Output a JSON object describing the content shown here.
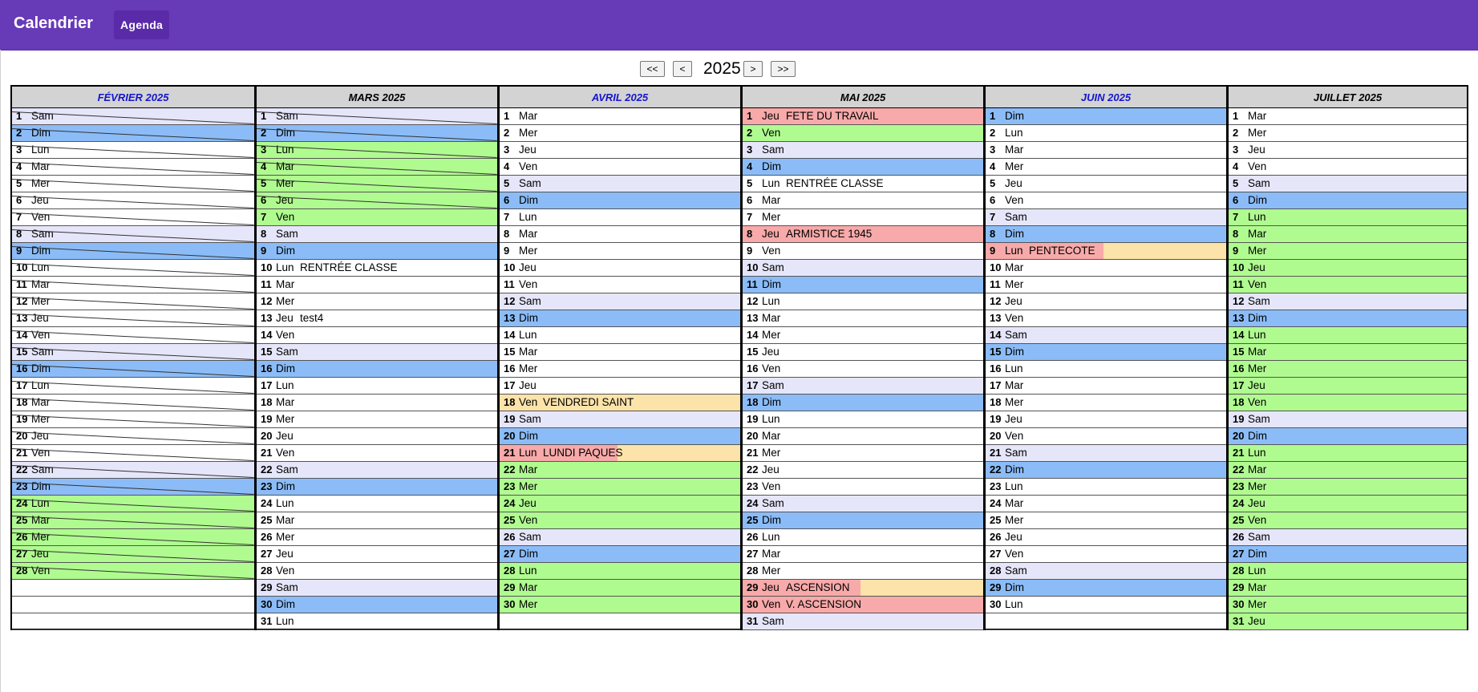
{
  "app": {
    "title": "Calendrier",
    "agenda_label": "Agenda"
  },
  "nav": {
    "year": "2025",
    "first": "<<",
    "prev": "<",
    "next": ">",
    "last": ">>"
  },
  "colors": {
    "appbar": "#673ab7",
    "saturday": "#e6e6fa",
    "sunday": "#8bbcf7",
    "school_holiday": "#b0fb90",
    "public_holiday": "#f8a9a9",
    "bridge_day": "#fbe3aa",
    "current_month_title": "#1515d0"
  },
  "months": [
    {
      "title": "FÉVRIER 2025",
      "title_blue": true,
      "days": [
        {
          "n": "1",
          "wd": "Sam",
          "c": "sat",
          "x": 1
        },
        {
          "n": "2",
          "wd": "Dim",
          "c": "sun",
          "x": 1
        },
        {
          "n": "3",
          "wd": "Lun",
          "x": 1
        },
        {
          "n": "4",
          "wd": "Mar",
          "x": 1
        },
        {
          "n": "5",
          "wd": "Mer",
          "x": 1
        },
        {
          "n": "6",
          "wd": "Jeu",
          "x": 1
        },
        {
          "n": "7",
          "wd": "Ven",
          "x": 1
        },
        {
          "n": "8",
          "wd": "Sam",
          "c": "sat",
          "x": 1
        },
        {
          "n": "9",
          "wd": "Dim",
          "c": "sun",
          "x": 1
        },
        {
          "n": "10",
          "wd": "Lun",
          "x": 1
        },
        {
          "n": "11",
          "wd": "Mar",
          "x": 1
        },
        {
          "n": "12",
          "wd": "Mer",
          "x": 1
        },
        {
          "n": "13",
          "wd": "Jeu",
          "x": 1
        },
        {
          "n": "14",
          "wd": "Ven",
          "x": 1
        },
        {
          "n": "15",
          "wd": "Sam",
          "c": "sat",
          "x": 1
        },
        {
          "n": "16",
          "wd": "Dim",
          "c": "sun",
          "x": 1
        },
        {
          "n": "17",
          "wd": "Lun",
          "x": 1
        },
        {
          "n": "18",
          "wd": "Mar",
          "x": 1
        },
        {
          "n": "19",
          "wd": "Mer",
          "x": 1
        },
        {
          "n": "20",
          "wd": "Jeu",
          "x": 1
        },
        {
          "n": "21",
          "wd": "Ven",
          "x": 1
        },
        {
          "n": "22",
          "wd": "Sam",
          "c": "sat",
          "x": 1
        },
        {
          "n": "23",
          "wd": "Dim",
          "c": "sun",
          "x": 1
        },
        {
          "n": "24",
          "wd": "Lun",
          "c": "green",
          "x": 1
        },
        {
          "n": "25",
          "wd": "Mar",
          "c": "green",
          "x": 1
        },
        {
          "n": "26",
          "wd": "Mer",
          "c": "green",
          "x": 1
        },
        {
          "n": "27",
          "wd": "Jeu",
          "c": "green",
          "x": 1
        },
        {
          "n": "28",
          "wd": "Ven",
          "c": "green",
          "x": 1
        }
      ]
    },
    {
      "title": "MARS 2025",
      "title_blue": false,
      "days": [
        {
          "n": "1",
          "wd": "Sam",
          "c": "sat",
          "x": 1
        },
        {
          "n": "2",
          "wd": "Dim",
          "c": "sun",
          "x": 1
        },
        {
          "n": "3",
          "wd": "Lun",
          "c": "green",
          "x": 1
        },
        {
          "n": "4",
          "wd": "Mar",
          "c": "green",
          "x": 1
        },
        {
          "n": "5",
          "wd": "Mer",
          "c": "green",
          "x": 1
        },
        {
          "n": "6",
          "wd": "Jeu",
          "c": "green",
          "x": 1
        },
        {
          "n": "7",
          "wd": "Ven",
          "c": "green"
        },
        {
          "n": "8",
          "wd": "Sam",
          "c": "sat"
        },
        {
          "n": "9",
          "wd": "Dim",
          "c": "sun"
        },
        {
          "n": "10",
          "wd": "Lun",
          "ev": "RENTRÉE CLASSE"
        },
        {
          "n": "11",
          "wd": "Mar"
        },
        {
          "n": "12",
          "wd": "Mer"
        },
        {
          "n": "13",
          "wd": "Jeu",
          "ev": "test4"
        },
        {
          "n": "14",
          "wd": "Ven"
        },
        {
          "n": "15",
          "wd": "Sam",
          "c": "sat"
        },
        {
          "n": "16",
          "wd": "Dim",
          "c": "sun"
        },
        {
          "n": "17",
          "wd": "Lun"
        },
        {
          "n": "18",
          "wd": "Mar"
        },
        {
          "n": "19",
          "wd": "Mer"
        },
        {
          "n": "20",
          "wd": "Jeu"
        },
        {
          "n": "21",
          "wd": "Ven"
        },
        {
          "n": "22",
          "wd": "Sam",
          "c": "sat"
        },
        {
          "n": "23",
          "wd": "Dim",
          "c": "sun"
        },
        {
          "n": "24",
          "wd": "Lun"
        },
        {
          "n": "25",
          "wd": "Mar"
        },
        {
          "n": "26",
          "wd": "Mer"
        },
        {
          "n": "27",
          "wd": "Jeu"
        },
        {
          "n": "28",
          "wd": "Ven"
        },
        {
          "n": "29",
          "wd": "Sam",
          "c": "sat"
        },
        {
          "n": "30",
          "wd": "Dim",
          "c": "sun"
        },
        {
          "n": "31",
          "wd": "Lun"
        }
      ]
    },
    {
      "title": "AVRIL 2025",
      "title_blue": true,
      "days": [
        {
          "n": "1",
          "wd": "Mar"
        },
        {
          "n": "2",
          "wd": "Mer"
        },
        {
          "n": "3",
          "wd": "Jeu"
        },
        {
          "n": "4",
          "wd": "Ven"
        },
        {
          "n": "5",
          "wd": "Sam",
          "c": "sat"
        },
        {
          "n": "6",
          "wd": "Dim",
          "c": "sun"
        },
        {
          "n": "7",
          "wd": "Lun"
        },
        {
          "n": "8",
          "wd": "Mar"
        },
        {
          "n": "9",
          "wd": "Mer"
        },
        {
          "n": "10",
          "wd": "Jeu"
        },
        {
          "n": "11",
          "wd": "Ven"
        },
        {
          "n": "12",
          "wd": "Sam",
          "c": "sat"
        },
        {
          "n": "13",
          "wd": "Dim",
          "c": "sun"
        },
        {
          "n": "14",
          "wd": "Lun"
        },
        {
          "n": "15",
          "wd": "Mar"
        },
        {
          "n": "16",
          "wd": "Mer"
        },
        {
          "n": "17",
          "wd": "Jeu"
        },
        {
          "n": "18",
          "wd": "Ven",
          "c": "yellow",
          "ev": "VENDREDI SAINT"
        },
        {
          "n": "19",
          "wd": "Sam",
          "c": "sat"
        },
        {
          "n": "20",
          "wd": "Dim",
          "c": "sun"
        },
        {
          "n": "21",
          "wd": "Lun",
          "c": "yellow",
          "split": 1,
          "ev": "LUNDI PAQUES"
        },
        {
          "n": "22",
          "wd": "Mar",
          "c": "green"
        },
        {
          "n": "23",
          "wd": "Mer",
          "c": "green"
        },
        {
          "n": "24",
          "wd": "Jeu",
          "c": "green"
        },
        {
          "n": "25",
          "wd": "Ven",
          "c": "green"
        },
        {
          "n": "26",
          "wd": "Sam",
          "c": "sat"
        },
        {
          "n": "27",
          "wd": "Dim",
          "c": "sun"
        },
        {
          "n": "28",
          "wd": "Lun",
          "c": "green"
        },
        {
          "n": "29",
          "wd": "Mar",
          "c": "green"
        },
        {
          "n": "30",
          "wd": "Mer",
          "c": "green"
        }
      ]
    },
    {
      "title": "MAI 2025",
      "title_blue": false,
      "days": [
        {
          "n": "1",
          "wd": "Jeu",
          "c": "red",
          "ev": "FETE DU TRAVAIL"
        },
        {
          "n": "2",
          "wd": "Ven",
          "c": "green"
        },
        {
          "n": "3",
          "wd": "Sam",
          "c": "sat"
        },
        {
          "n": "4",
          "wd": "Dim",
          "c": "sun"
        },
        {
          "n": "5",
          "wd": "Lun",
          "ev": "RENTRÉE CLASSE"
        },
        {
          "n": "6",
          "wd": "Mar"
        },
        {
          "n": "7",
          "wd": "Mer"
        },
        {
          "n": "8",
          "wd": "Jeu",
          "c": "red",
          "ev": "ARMISTICE 1945"
        },
        {
          "n": "9",
          "wd": "Ven"
        },
        {
          "n": "10",
          "wd": "Sam",
          "c": "sat"
        },
        {
          "n": "11",
          "wd": "Dim",
          "c": "sun"
        },
        {
          "n": "12",
          "wd": "Lun"
        },
        {
          "n": "13",
          "wd": "Mar"
        },
        {
          "n": "14",
          "wd": "Mer"
        },
        {
          "n": "15",
          "wd": "Jeu"
        },
        {
          "n": "16",
          "wd": "Ven"
        },
        {
          "n": "17",
          "wd": "Sam",
          "c": "sat"
        },
        {
          "n": "18",
          "wd": "Dim",
          "c": "sun"
        },
        {
          "n": "19",
          "wd": "Lun"
        },
        {
          "n": "20",
          "wd": "Mar"
        },
        {
          "n": "21",
          "wd": "Mer"
        },
        {
          "n": "22",
          "wd": "Jeu"
        },
        {
          "n": "23",
          "wd": "Ven"
        },
        {
          "n": "24",
          "wd": "Sam",
          "c": "sat"
        },
        {
          "n": "25",
          "wd": "Dim",
          "c": "sun"
        },
        {
          "n": "26",
          "wd": "Lun"
        },
        {
          "n": "27",
          "wd": "Mar"
        },
        {
          "n": "28",
          "wd": "Mer"
        },
        {
          "n": "29",
          "wd": "Jeu",
          "c": "yellow",
          "split": 1,
          "ev": "ASCENSION"
        },
        {
          "n": "30",
          "wd": "Ven",
          "c": "red",
          "ev": "V. ASCENSION"
        },
        {
          "n": "31",
          "wd": "Sam",
          "c": "sat"
        }
      ]
    },
    {
      "title": "JUIN 2025",
      "title_blue": true,
      "days": [
        {
          "n": "1",
          "wd": "Dim",
          "c": "sun"
        },
        {
          "n": "2",
          "wd": "Lun"
        },
        {
          "n": "3",
          "wd": "Mar"
        },
        {
          "n": "4",
          "wd": "Mer"
        },
        {
          "n": "5",
          "wd": "Jeu"
        },
        {
          "n": "6",
          "wd": "Ven"
        },
        {
          "n": "7",
          "wd": "Sam",
          "c": "sat"
        },
        {
          "n": "8",
          "wd": "Dim",
          "c": "sun"
        },
        {
          "n": "9",
          "wd": "Lun",
          "c": "yellow",
          "split": 1,
          "ev": "PENTECOTE"
        },
        {
          "n": "10",
          "wd": "Mar"
        },
        {
          "n": "11",
          "wd": "Mer"
        },
        {
          "n": "12",
          "wd": "Jeu"
        },
        {
          "n": "13",
          "wd": "Ven"
        },
        {
          "n": "14",
          "wd": "Sam",
          "c": "sat"
        },
        {
          "n": "15",
          "wd": "Dim",
          "c": "sun"
        },
        {
          "n": "16",
          "wd": "Lun"
        },
        {
          "n": "17",
          "wd": "Mar"
        },
        {
          "n": "18",
          "wd": "Mer"
        },
        {
          "n": "19",
          "wd": "Jeu"
        },
        {
          "n": "20",
          "wd": "Ven"
        },
        {
          "n": "21",
          "wd": "Sam",
          "c": "sat"
        },
        {
          "n": "22",
          "wd": "Dim",
          "c": "sun"
        },
        {
          "n": "23",
          "wd": "Lun"
        },
        {
          "n": "24",
          "wd": "Mar"
        },
        {
          "n": "25",
          "wd": "Mer"
        },
        {
          "n": "26",
          "wd": "Jeu"
        },
        {
          "n": "27",
          "wd": "Ven"
        },
        {
          "n": "28",
          "wd": "Sam",
          "c": "sat"
        },
        {
          "n": "29",
          "wd": "Dim",
          "c": "sun"
        },
        {
          "n": "30",
          "wd": "Lun"
        }
      ]
    },
    {
      "title": "JUILLET 2025",
      "title_blue": false,
      "days": [
        {
          "n": "1",
          "wd": "Mar"
        },
        {
          "n": "2",
          "wd": "Mer"
        },
        {
          "n": "3",
          "wd": "Jeu"
        },
        {
          "n": "4",
          "wd": "Ven"
        },
        {
          "n": "5",
          "wd": "Sam",
          "c": "sat"
        },
        {
          "n": "6",
          "wd": "Dim",
          "c": "sun"
        },
        {
          "n": "7",
          "wd": "Lun",
          "c": "green"
        },
        {
          "n": "8",
          "wd": "Mar",
          "c": "green"
        },
        {
          "n": "9",
          "wd": "Mer",
          "c": "green"
        },
        {
          "n": "10",
          "wd": "Jeu",
          "c": "green"
        },
        {
          "n": "11",
          "wd": "Ven",
          "c": "green"
        },
        {
          "n": "12",
          "wd": "Sam",
          "c": "sat"
        },
        {
          "n": "13",
          "wd": "Dim",
          "c": "sun"
        },
        {
          "n": "14",
          "wd": "Lun",
          "c": "green"
        },
        {
          "n": "15",
          "wd": "Mar",
          "c": "green"
        },
        {
          "n": "16",
          "wd": "Mer",
          "c": "green"
        },
        {
          "n": "17",
          "wd": "Jeu",
          "c": "green"
        },
        {
          "n": "18",
          "wd": "Ven",
          "c": "green"
        },
        {
          "n": "19",
          "wd": "Sam",
          "c": "sat"
        },
        {
          "n": "20",
          "wd": "Dim",
          "c": "sun"
        },
        {
          "n": "21",
          "wd": "Lun",
          "c": "green"
        },
        {
          "n": "22",
          "wd": "Mar",
          "c": "green"
        },
        {
          "n": "23",
          "wd": "Mer",
          "c": "green"
        },
        {
          "n": "24",
          "wd": "Jeu",
          "c": "green"
        },
        {
          "n": "25",
          "wd": "Ven",
          "c": "green"
        },
        {
          "n": "26",
          "wd": "Sam",
          "c": "sat"
        },
        {
          "n": "27",
          "wd": "Dim",
          "c": "sun"
        },
        {
          "n": "28",
          "wd": "Lun",
          "c": "green"
        },
        {
          "n": "29",
          "wd": "Mar",
          "c": "green"
        },
        {
          "n": "30",
          "wd": "Mer",
          "c": "green"
        },
        {
          "n": "31",
          "wd": "Jeu",
          "c": "green"
        }
      ]
    }
  ]
}
